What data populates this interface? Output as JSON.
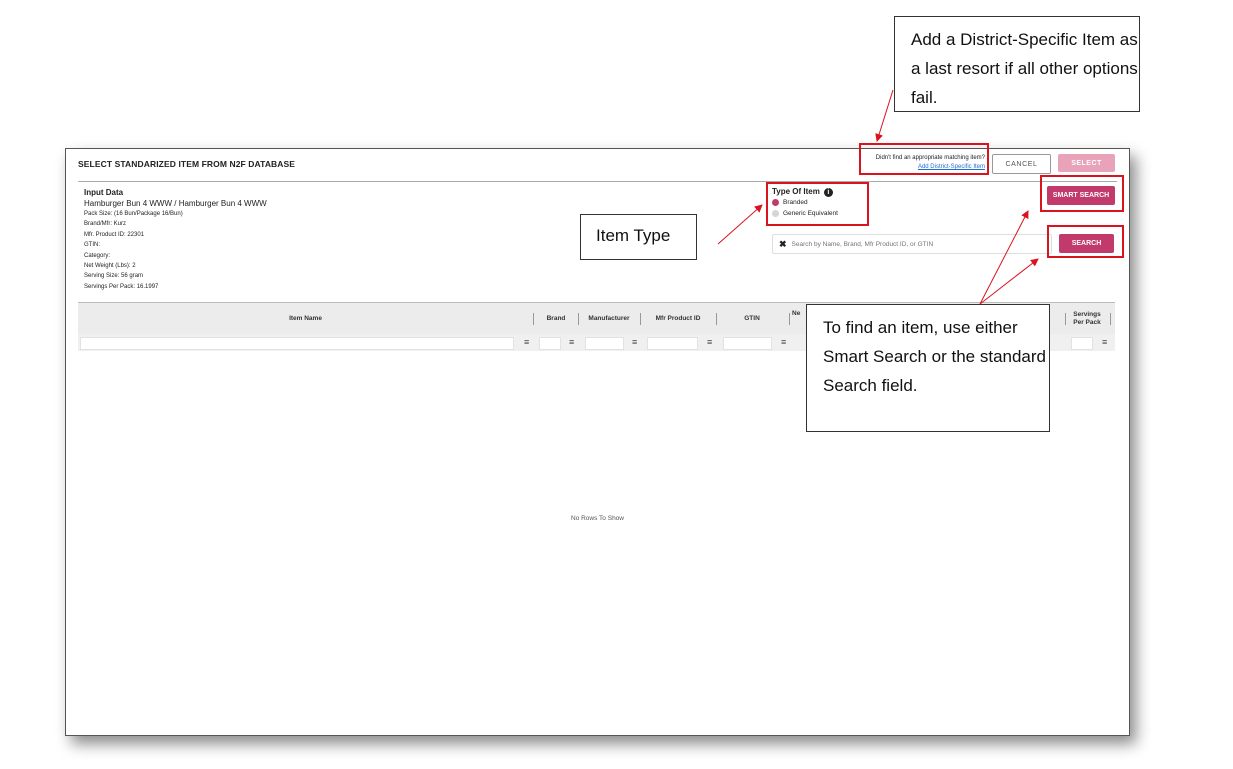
{
  "modal": {
    "title": "SELECT STANDARIZED ITEM FROM N2F DATABASE",
    "not_found_text": "Didn't find an appropriate matching item?",
    "add_district_link": "Add District-Specific Item",
    "cancel_label": "CANCEL",
    "select_label": "SELECT"
  },
  "input_data": {
    "label": "Input Data",
    "item_name": "Hamburger Bun 4 WWW / Hamburger Bun 4 WWW",
    "lines": [
      "Pack Size: (16 Bun/Package 16/Bun)",
      "Brand/Mfr: Kurz",
      "Mfr. Product ID: 22301",
      "GTIN:",
      "Category:",
      "Net Weight (Lbs): 2",
      "Serving Size: 56 gram",
      "Servings Per Pack: 16.1997"
    ]
  },
  "type_of_item": {
    "title": "Type Of Item",
    "options": [
      {
        "label": "Branded",
        "selected": true
      },
      {
        "label": "Generic Equivalent",
        "selected": false
      }
    ]
  },
  "smart_search_label": "SMART SEARCH",
  "search": {
    "placeholder": "Search by Name, Brand, Mfr Product ID, or GTIN",
    "button_label": "SEARCH"
  },
  "grid": {
    "columns": [
      "Item Name",
      "Brand",
      "Manufacturer",
      "Mfr Product ID",
      "GTIN",
      "Ne",
      "Servings Per Pack"
    ],
    "empty_text": "No Rows To Show"
  },
  "callouts": {
    "district": "Add a District-Specific Item as a last resort if all other options fail.",
    "item_type": "Item Type",
    "find_item": "To find an item, use either Smart Search or the standard Search field."
  },
  "colors": {
    "accent": "#c23a6b",
    "accent_disabled": "#e8a3b8",
    "annotation_red": "#d9141f",
    "link": "#1c6fd1"
  }
}
